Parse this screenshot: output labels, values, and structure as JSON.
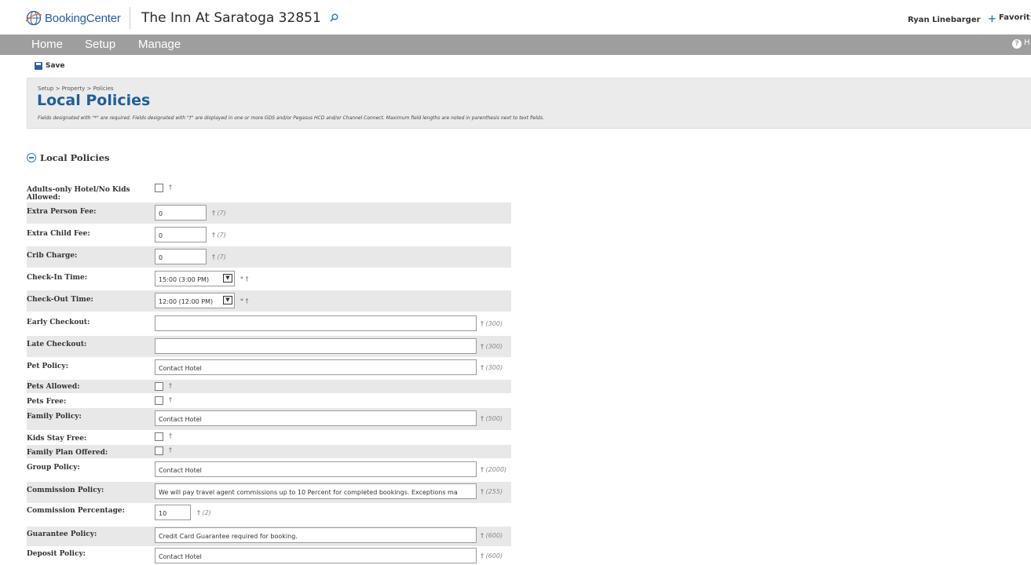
{
  "header": {
    "logo_text": "BookingCenter",
    "property_name": "The Inn At Saratoga 32851",
    "user_name": "Ryan Linebarger",
    "favorites_label": "Favorit"
  },
  "nav": {
    "items": [
      "Home",
      "Setup",
      "Manage"
    ],
    "help_label": "H"
  },
  "toolbar": {
    "save_label": "Save"
  },
  "page": {
    "breadcrumb": "Setup > Property > Policies",
    "title": "Local Policies",
    "note": "Fields designated with \"*\" are required. Fields designated with \"†\" are displayed in one or more GDS and/or Pegasus HCD and/or Channel Connect. Maximum field lengths are noted in parenthesis next to text fields."
  },
  "section": {
    "title": "Local Policies"
  },
  "fields": {
    "adults_only": {
      "label": "Adults-only Hotel/No Kids Allowed:",
      "mark": "†",
      "checked": false
    },
    "extra_person_fee": {
      "label": "Extra Person Fee:",
      "value": "0",
      "mark": "†",
      "maxlen": "(7)"
    },
    "extra_child_fee": {
      "label": "Extra Child Fee:",
      "value": "0",
      "mark": "†",
      "maxlen": "(7)"
    },
    "crib_charge": {
      "label": "Crib Charge:",
      "value": "0",
      "mark": "†",
      "maxlen": "(7)"
    },
    "check_in_time": {
      "label": "Check-In Time:",
      "value": "15:00 (3:00 PM)",
      "mark": "* †"
    },
    "check_out_time": {
      "label": "Check-Out Time:",
      "value": "12:00 (12:00 PM)",
      "mark": "* †"
    },
    "early_checkout": {
      "label": "Early Checkout:",
      "value": "",
      "mark": "†",
      "maxlen": "(300)"
    },
    "late_checkout": {
      "label": "Late Checkout:",
      "value": "",
      "mark": "†",
      "maxlen": "(300)"
    },
    "pet_policy": {
      "label": "Pet Policy:",
      "value": "Contact Hotel",
      "mark": "†",
      "maxlen": "(300)"
    },
    "pets_allowed": {
      "label": "Pets Allowed:",
      "mark": "†",
      "checked": false
    },
    "pets_free": {
      "label": "Pets Free:",
      "mark": "†",
      "checked": false
    },
    "family_policy": {
      "label": "Family Policy:",
      "value": "Contact Hotel",
      "mark": "†",
      "maxlen": "(500)"
    },
    "kids_stay_free": {
      "label": "Kids Stay Free:",
      "mark": "†",
      "checked": false
    },
    "family_plan_offered": {
      "label": "Family Plan Offered:",
      "mark": "†",
      "checked": false
    },
    "group_policy": {
      "label": "Group Policy:",
      "value": "Contact Hotel",
      "mark": "†",
      "maxlen": "(2000)"
    },
    "commission_policy": {
      "label": "Commission Policy:",
      "value": "We will pay travel agent commissions up to 10 Percent for completed bookings. Exceptions ma",
      "mark": "†",
      "maxlen": "(255)"
    },
    "commission_percentage": {
      "label": "Commission Percentage:",
      "value": "10",
      "mark": "†",
      "maxlen": "(2)"
    },
    "guarantee_policy": {
      "label": "Guarantee Policy:",
      "value": "Credit Card Guarantee required for booking.",
      "mark": "†",
      "maxlen": "(600)"
    },
    "deposit_policy": {
      "label": "Deposit Policy:",
      "value": "Contact Hotel",
      "mark": "†",
      "maxlen": "(600)"
    }
  }
}
